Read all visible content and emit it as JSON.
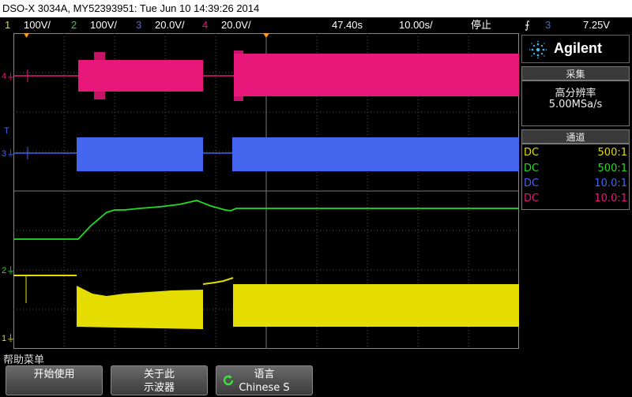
{
  "title_bar": {
    "text": "DSO-X 3034A, MY52393951: Tue Jun 10 14:39:26 2014"
  },
  "status_bar": {
    "ch1_num": "1",
    "ch1_scale": "100V/",
    "ch2_num": "2",
    "ch2_scale": "100V/",
    "ch3_num": "3",
    "ch3_scale": "20.0V/",
    "ch4_num": "4",
    "ch4_scale": "20.0V/",
    "time_delay": "47.40s",
    "time_scale": "10.00s/",
    "run_state": "停止",
    "trigger_slope": "⨍",
    "trigger_source": "3",
    "trigger_level": "7.25V"
  },
  "colors": {
    "ch1": "#e6dd00",
    "ch2": "#22dd22",
    "ch3": "#4466ee",
    "ch4": "#e8187a",
    "trigger_orange": "#ff9a1a",
    "grid": "#555555"
  },
  "channel_markers": {
    "ch4_label": "4",
    "ch3_label": "3",
    "ch2_label": "2",
    "ch1_label": "1",
    "trigger_T": "T"
  },
  "brand": {
    "name": "Agilent",
    "logo_icon": "agilent-starburst-icon"
  },
  "acquisition": {
    "header": "采集",
    "mode": "高分辨率",
    "sample_rate": "5.00MSa/s"
  },
  "channels_panel": {
    "header": "通道",
    "rows": [
      {
        "coupling": "DC",
        "ratio": "500:1",
        "color": "#e6dd00"
      },
      {
        "coupling": "DC",
        "ratio": "500:1",
        "color": "#22dd22"
      },
      {
        "coupling": "DC",
        "ratio": "10.0:1",
        "color": "#4466ee"
      },
      {
        "coupling": "DC",
        "ratio": "10.0:1",
        "color": "#e8187a"
      }
    ]
  },
  "softkeys": {
    "menu_title": "帮助菜单",
    "key1": "开始使用",
    "key2_line1": "关于此",
    "key2_line2": "示波器",
    "key3_line1": "语言",
    "key3_line2": "Chinese S"
  }
}
